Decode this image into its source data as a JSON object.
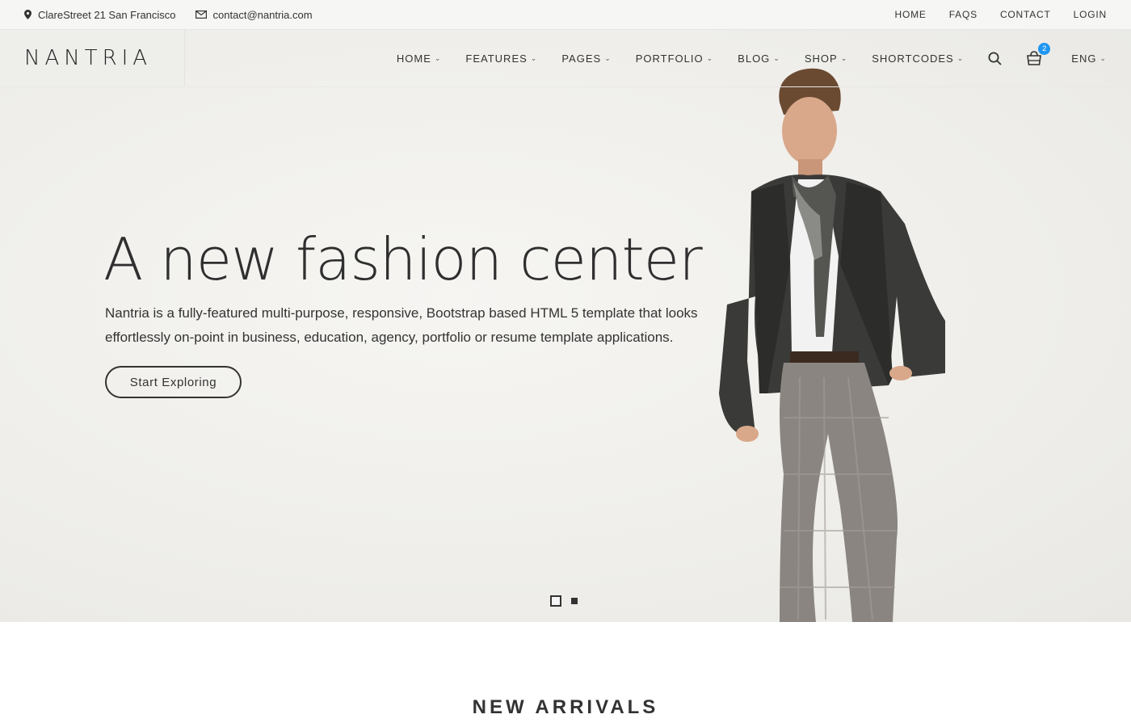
{
  "topbar": {
    "address": "ClareStreet 21 San Francisco",
    "email": "contact@nantria.com",
    "links": [
      "HOME",
      "FAQS",
      "CONTACT",
      "LOGIN"
    ]
  },
  "header": {
    "logo": "NANTRIA",
    "nav": [
      {
        "label": "HOME"
      },
      {
        "label": "FEATURES"
      },
      {
        "label": "PAGES"
      },
      {
        "label": "PORTFOLIO"
      },
      {
        "label": "BLOG"
      },
      {
        "label": "SHOP"
      },
      {
        "label": "SHORTCODES"
      }
    ],
    "cart_count": "2",
    "language": "ENG"
  },
  "hero": {
    "title": "A new fashion center",
    "text": "Nantria is a fully-featured multi-purpose, responsive, Bootstrap based HTML 5 template that looks effortlessly on-point in business, education, agency, portfolio or resume template applications.",
    "button": "Start Exploring",
    "slides": 2,
    "active_slide": 1
  },
  "section": {
    "title": "NEW ARRIVALS"
  },
  "icons": {
    "address": "map-pin-icon",
    "email": "envelope-icon",
    "search": "search-icon",
    "cart": "shopping-bag-icon",
    "dropdown": "chevron-down-icon"
  },
  "colors": {
    "badge": "#2196f3",
    "text": "#333333",
    "hero_bg": "#efeeea"
  }
}
